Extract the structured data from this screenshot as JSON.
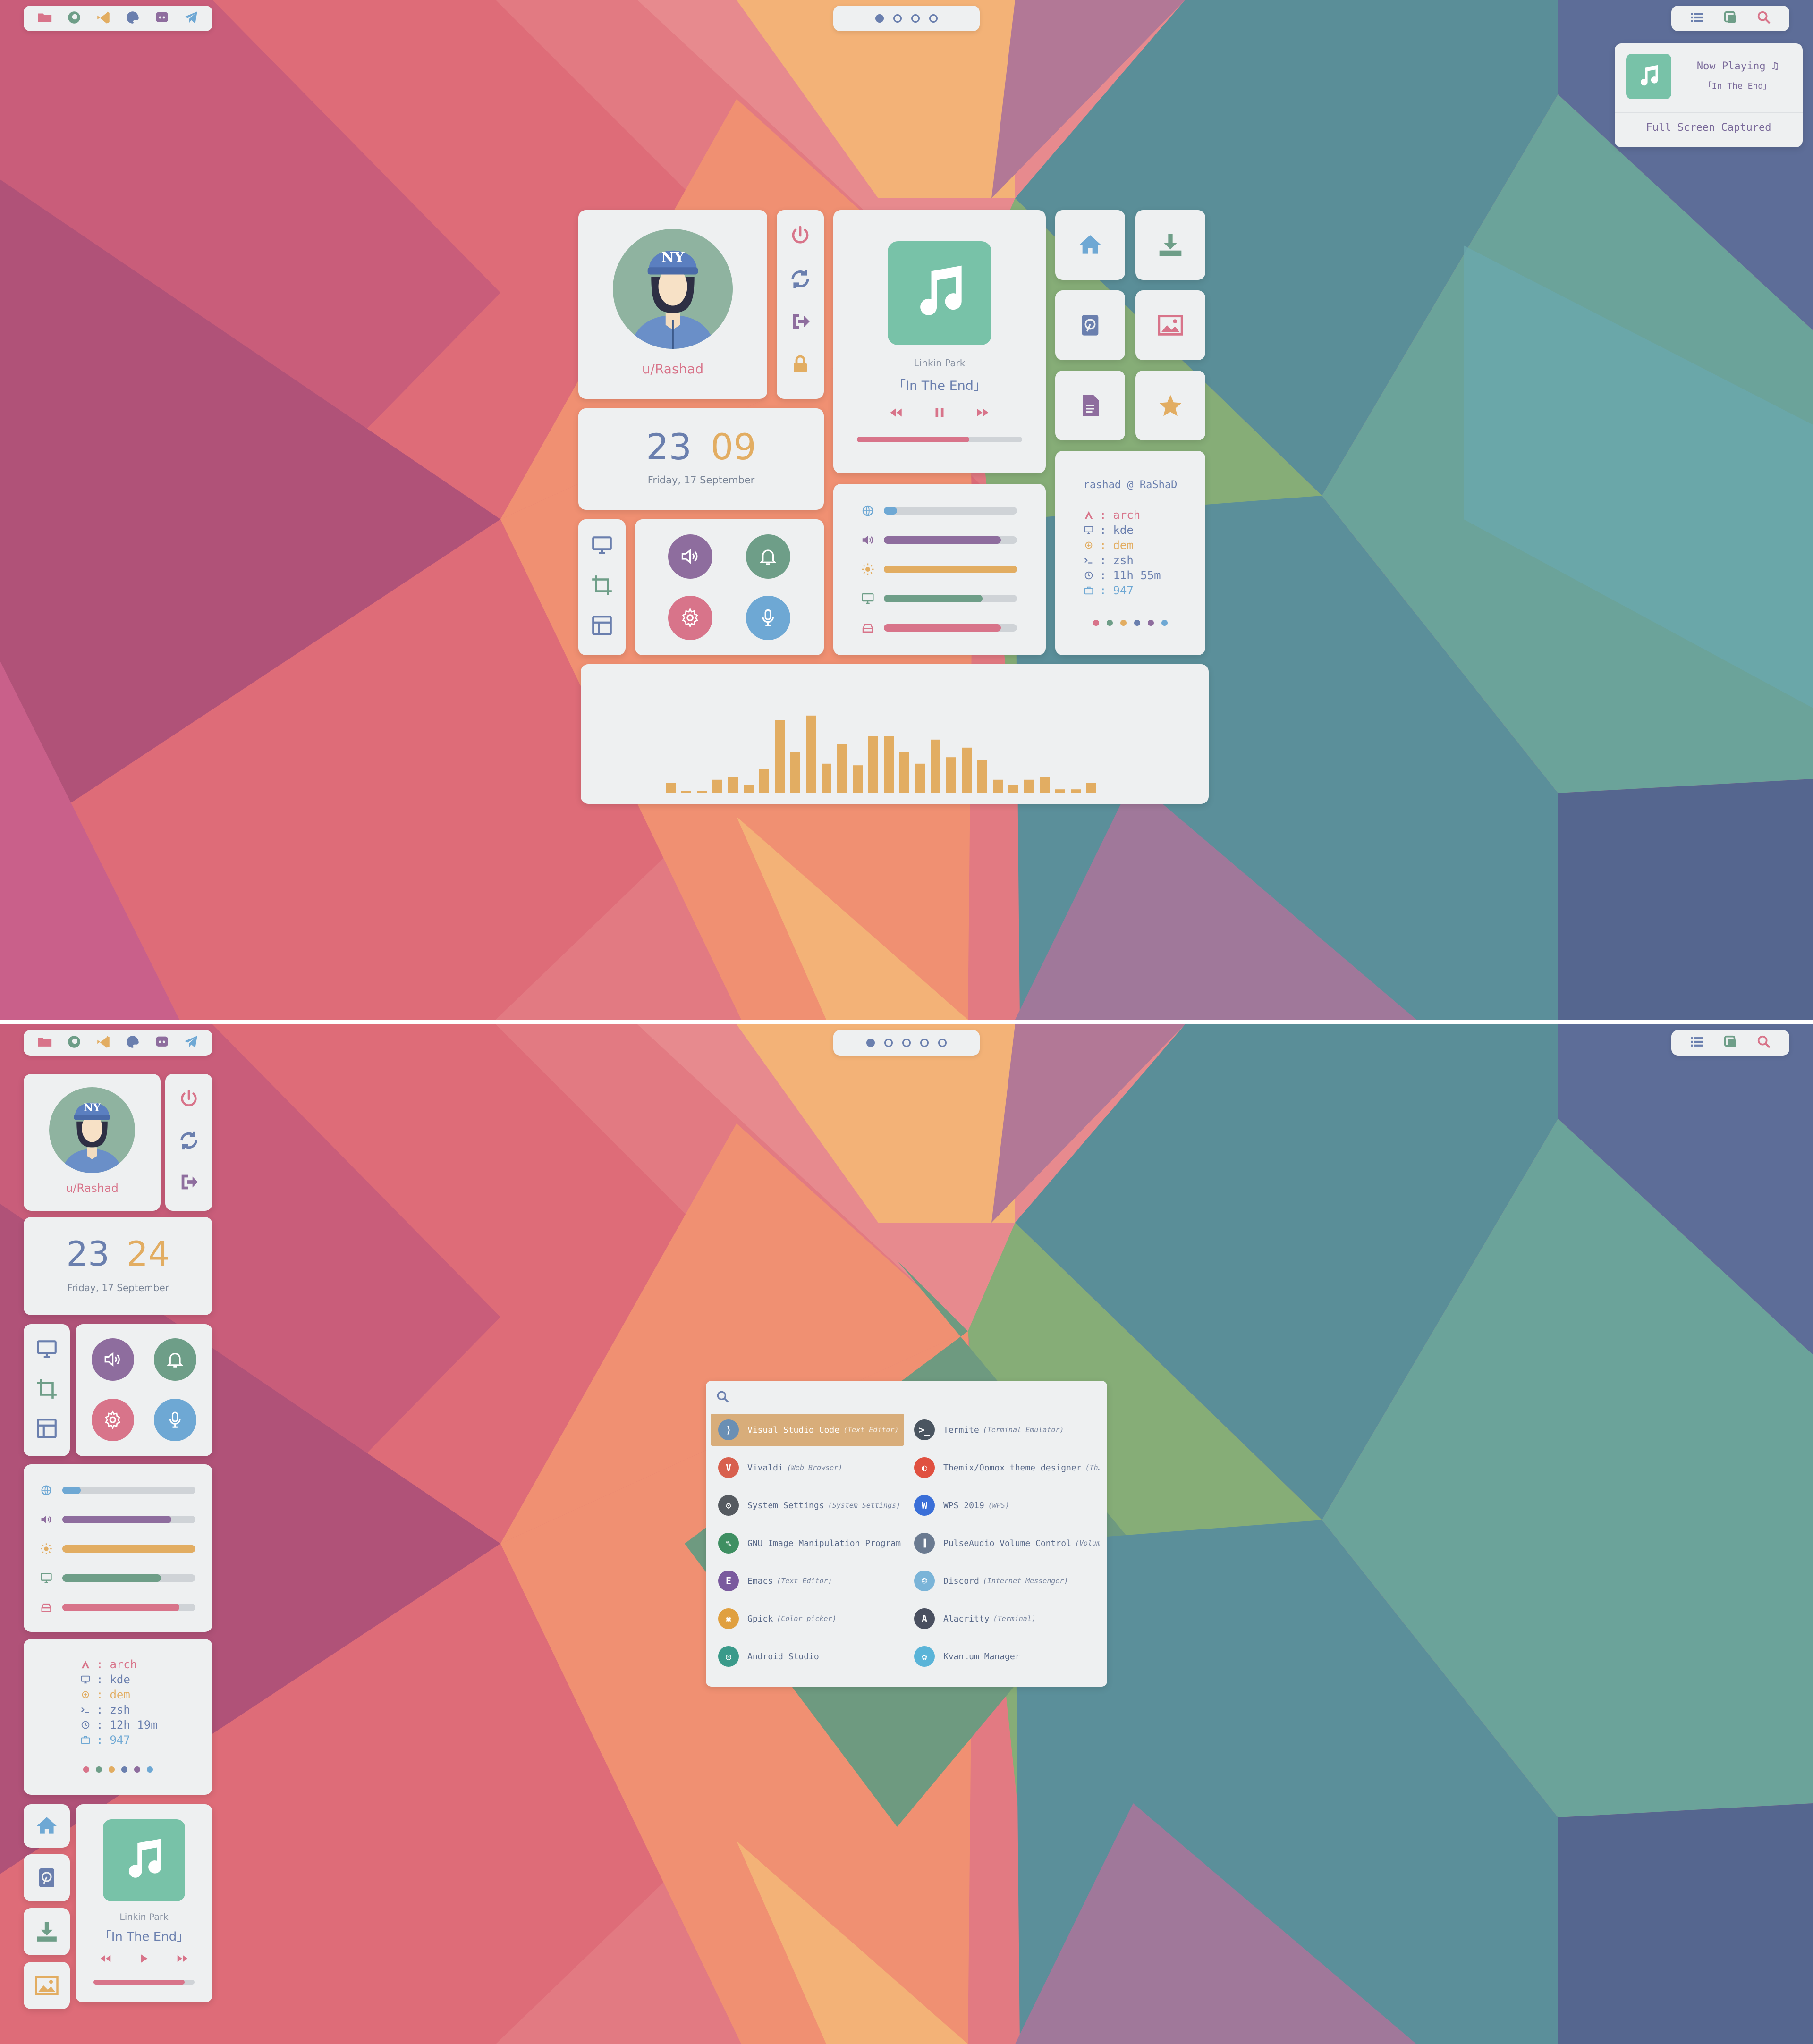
{
  "colors": {
    "blue": "#6a7fae",
    "teal": "#78c2a8",
    "pink": "#d8748a",
    "purple": "#8e6d9e",
    "orange": "#e2ad62",
    "green": "#6e9e88",
    "lightblue": "#6ea8d4"
  },
  "screen1": {
    "topbar_left_icons": [
      "folder-icon",
      "firefox-icon",
      "vscode-icon",
      "palette-icon",
      "discord-icon",
      "telegram-icon"
    ],
    "workspace_dots": [
      true,
      false,
      false,
      false
    ],
    "topbar_right_icons": [
      "list-icon",
      "screenshot-icon",
      "search-icon"
    ],
    "notification": {
      "title": "Now Playing ♫",
      "song": "「In The End」",
      "footer": "Full Screen Captured"
    },
    "profile": {
      "username": "u/Rashad",
      "cap_text": "NY"
    },
    "clock": {
      "hour": "23",
      "minute": "09",
      "date": "Friday, 17 September"
    },
    "music": {
      "artist": "Linkin Park",
      "title": "「In The End」",
      "progress": 0.68
    },
    "sliders": [
      {
        "icon": "wifi-icon",
        "level": 0.1,
        "color": "#6ea8d4"
      },
      {
        "icon": "volume-icon",
        "level": 0.88,
        "color": "#8e6d9e"
      },
      {
        "icon": "brightness-icon",
        "level": 1.0,
        "color": "#e2ad62"
      },
      {
        "icon": "monitor-icon",
        "level": 0.74,
        "color": "#6e9e88"
      },
      {
        "icon": "disk-icon",
        "level": 0.88,
        "color": "#d8748a"
      }
    ],
    "fetch": {
      "header": "rashad @ RaShaD",
      "rows": [
        {
          "key": "arch",
          "color": "#d8748a"
        },
        {
          "key": "kde",
          "color": "#6a7fae"
        },
        {
          "key": "dem",
          "color": "#e2ad62"
        },
        {
          "key": "zsh",
          "color": "#6a7fae"
        },
        {
          "key": "11h 55m",
          "color": "#6a7fae"
        },
        {
          "key": "947",
          "color": "#6ea8d4"
        }
      ]
    },
    "visualizer": [
      6,
      1,
      1,
      8,
      10,
      5,
      15,
      45,
      25,
      48,
      18,
      30,
      17,
      35,
      35,
      25,
      18,
      33,
      22,
      28,
      20,
      8,
      5,
      8,
      10,
      2,
      2,
      6
    ]
  },
  "screen2": {
    "workspace_dots": [
      true,
      false,
      false,
      false,
      false
    ],
    "profile": {
      "username": "u/Rashad",
      "cap_text": "NY"
    },
    "clock": {
      "hour": "23",
      "minute": "24",
      "date": "Friday, 17 September"
    },
    "sliders": [
      {
        "level": 0.14,
        "color": "#6ea8d4"
      },
      {
        "level": 0.82,
        "color": "#8e6d9e"
      },
      {
        "level": 1.0,
        "color": "#e2ad62"
      },
      {
        "level": 0.74,
        "color": "#6e9e88"
      },
      {
        "level": 0.88,
        "color": "#d8748a"
      }
    ],
    "fetch": {
      "rows": [
        {
          "key": "arch",
          "color": "#d8748a"
        },
        {
          "key": "kde",
          "color": "#6a7fae"
        },
        {
          "key": "dem",
          "color": "#e2ad62"
        },
        {
          "key": "zsh",
          "color": "#6a7fae"
        },
        {
          "key": "12h 19m",
          "color": "#6a7fae"
        },
        {
          "key": "947",
          "color": "#6ea8d4"
        }
      ]
    },
    "music": {
      "artist": "Linkin Park",
      "title": "「In The End」",
      "progress": 0.9
    },
    "launcher": {
      "search_value": "",
      "apps": [
        {
          "name": "Visual Studio Code",
          "cat": "(Text Editor)",
          "icon": "vscode-icon",
          "color": "#6a8fb4",
          "selected": true
        },
        {
          "name": "Termite",
          "cat": "(Terminal Emulator)",
          "icon": "terminal-icon",
          "color": "#4a5560"
        },
        {
          "name": "Vivaldi",
          "cat": "(Web Browser)",
          "icon": "vivaldi-icon",
          "color": "#d8604e"
        },
        {
          "name": "Themix/Oomox theme designer",
          "cat": "(Th…",
          "icon": "oomox-icon",
          "color": "#e05040"
        },
        {
          "name": "System Settings",
          "cat": "(System Settings)",
          "icon": "settings-icon",
          "color": "#555a60"
        },
        {
          "name": "WPS 2019",
          "cat": "(WPS)",
          "icon": "wps-icon",
          "color": "#3a6fd8"
        },
        {
          "name": "GNU Image Manipulation Program …",
          "cat": "",
          "icon": "gimp-icon",
          "color": "#3e8f62"
        },
        {
          "name": "PulseAudio Volume Control",
          "cat": "(Volum…",
          "icon": "mixer-icon",
          "color": "#6a7a90"
        },
        {
          "name": "Emacs",
          "cat": "(Text Editor)",
          "icon": "emacs-icon",
          "color": "#7a5a9e"
        },
        {
          "name": "Discord",
          "cat": "(Internet Messenger)",
          "icon": "discord-icon",
          "color": "#7ab4d8"
        },
        {
          "name": "Gpick",
          "cat": "(Color picker)",
          "icon": "gpick-icon",
          "color": "#e0a040"
        },
        {
          "name": "Alacritty",
          "cat": "(Terminal)",
          "icon": "alacritty-icon",
          "color": "#4a5060"
        },
        {
          "name": "Android Studio",
          "cat": "",
          "icon": "android-studio-icon",
          "color": "#3a9a8a"
        },
        {
          "name": "Kvantum Manager",
          "cat": "",
          "icon": "kvantum-icon",
          "color": "#5ab4d8"
        }
      ]
    }
  }
}
